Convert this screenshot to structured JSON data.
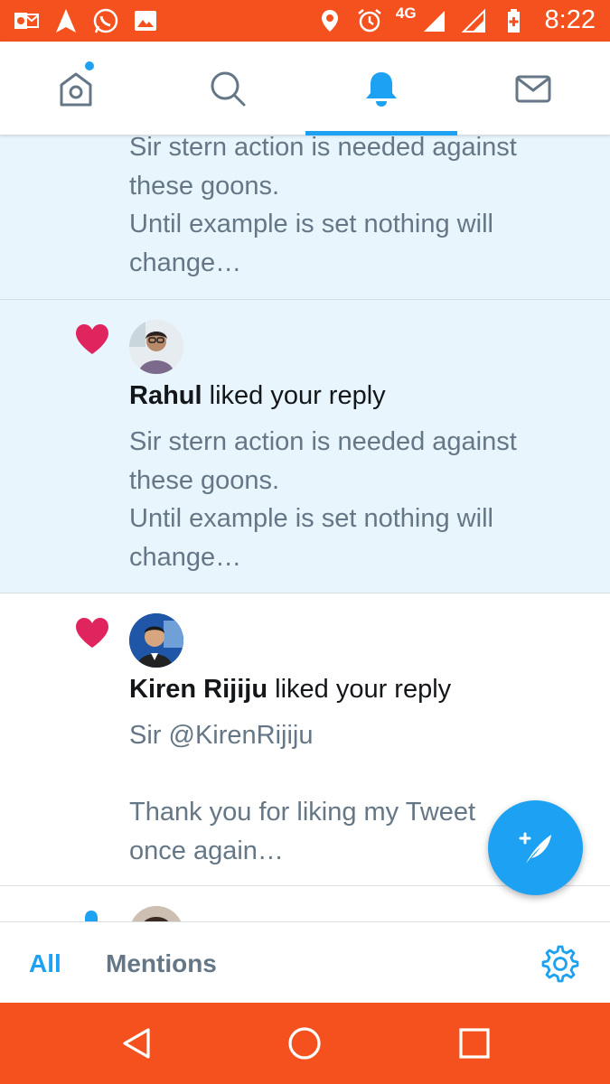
{
  "status_bar": {
    "time": "8:22",
    "network": "4G",
    "icons_left": [
      "outlook-icon",
      "navigation-icon",
      "whatsapp-icon",
      "gallery-icon"
    ],
    "icons_right": [
      "location-icon",
      "alarm-icon",
      "signal-icon",
      "signal-icon",
      "battery-icon"
    ],
    "color": "#f4511e"
  },
  "top_nav": {
    "tabs": [
      {
        "name": "home",
        "icon": "home-icon",
        "has_dot": true
      },
      {
        "name": "search",
        "icon": "search-icon",
        "has_dot": false
      },
      {
        "name": "notifications",
        "icon": "bell-icon",
        "active": true
      },
      {
        "name": "messages",
        "icon": "mail-icon",
        "has_dot": false
      }
    ],
    "accent": "#1da1f2"
  },
  "notifications": [
    {
      "type": "like",
      "unread": true,
      "partial": true,
      "text": "Sir stern action is needed against\nthese goons.\nUntil example is set nothing will\nchange…"
    },
    {
      "type": "like",
      "unread": true,
      "user": "Rahul",
      "action": " liked your reply",
      "text": "Sir stern action is needed against\nthese goons.\nUntil example is set nothing will\nchange…"
    },
    {
      "type": "like",
      "unread": false,
      "user": "Kiren Rijiju",
      "action": " liked your reply",
      "text": "Sir @KirenRijiju\n\nThank you for liking my Tweet\nonce again…"
    }
  ],
  "bottom_tabs": {
    "all": "All",
    "mentions": "Mentions"
  },
  "compose_icon": "compose-tweet-icon",
  "settings_icon": "gear-icon",
  "system_nav": [
    "back-icon",
    "home-circle-icon",
    "recents-icon"
  ]
}
